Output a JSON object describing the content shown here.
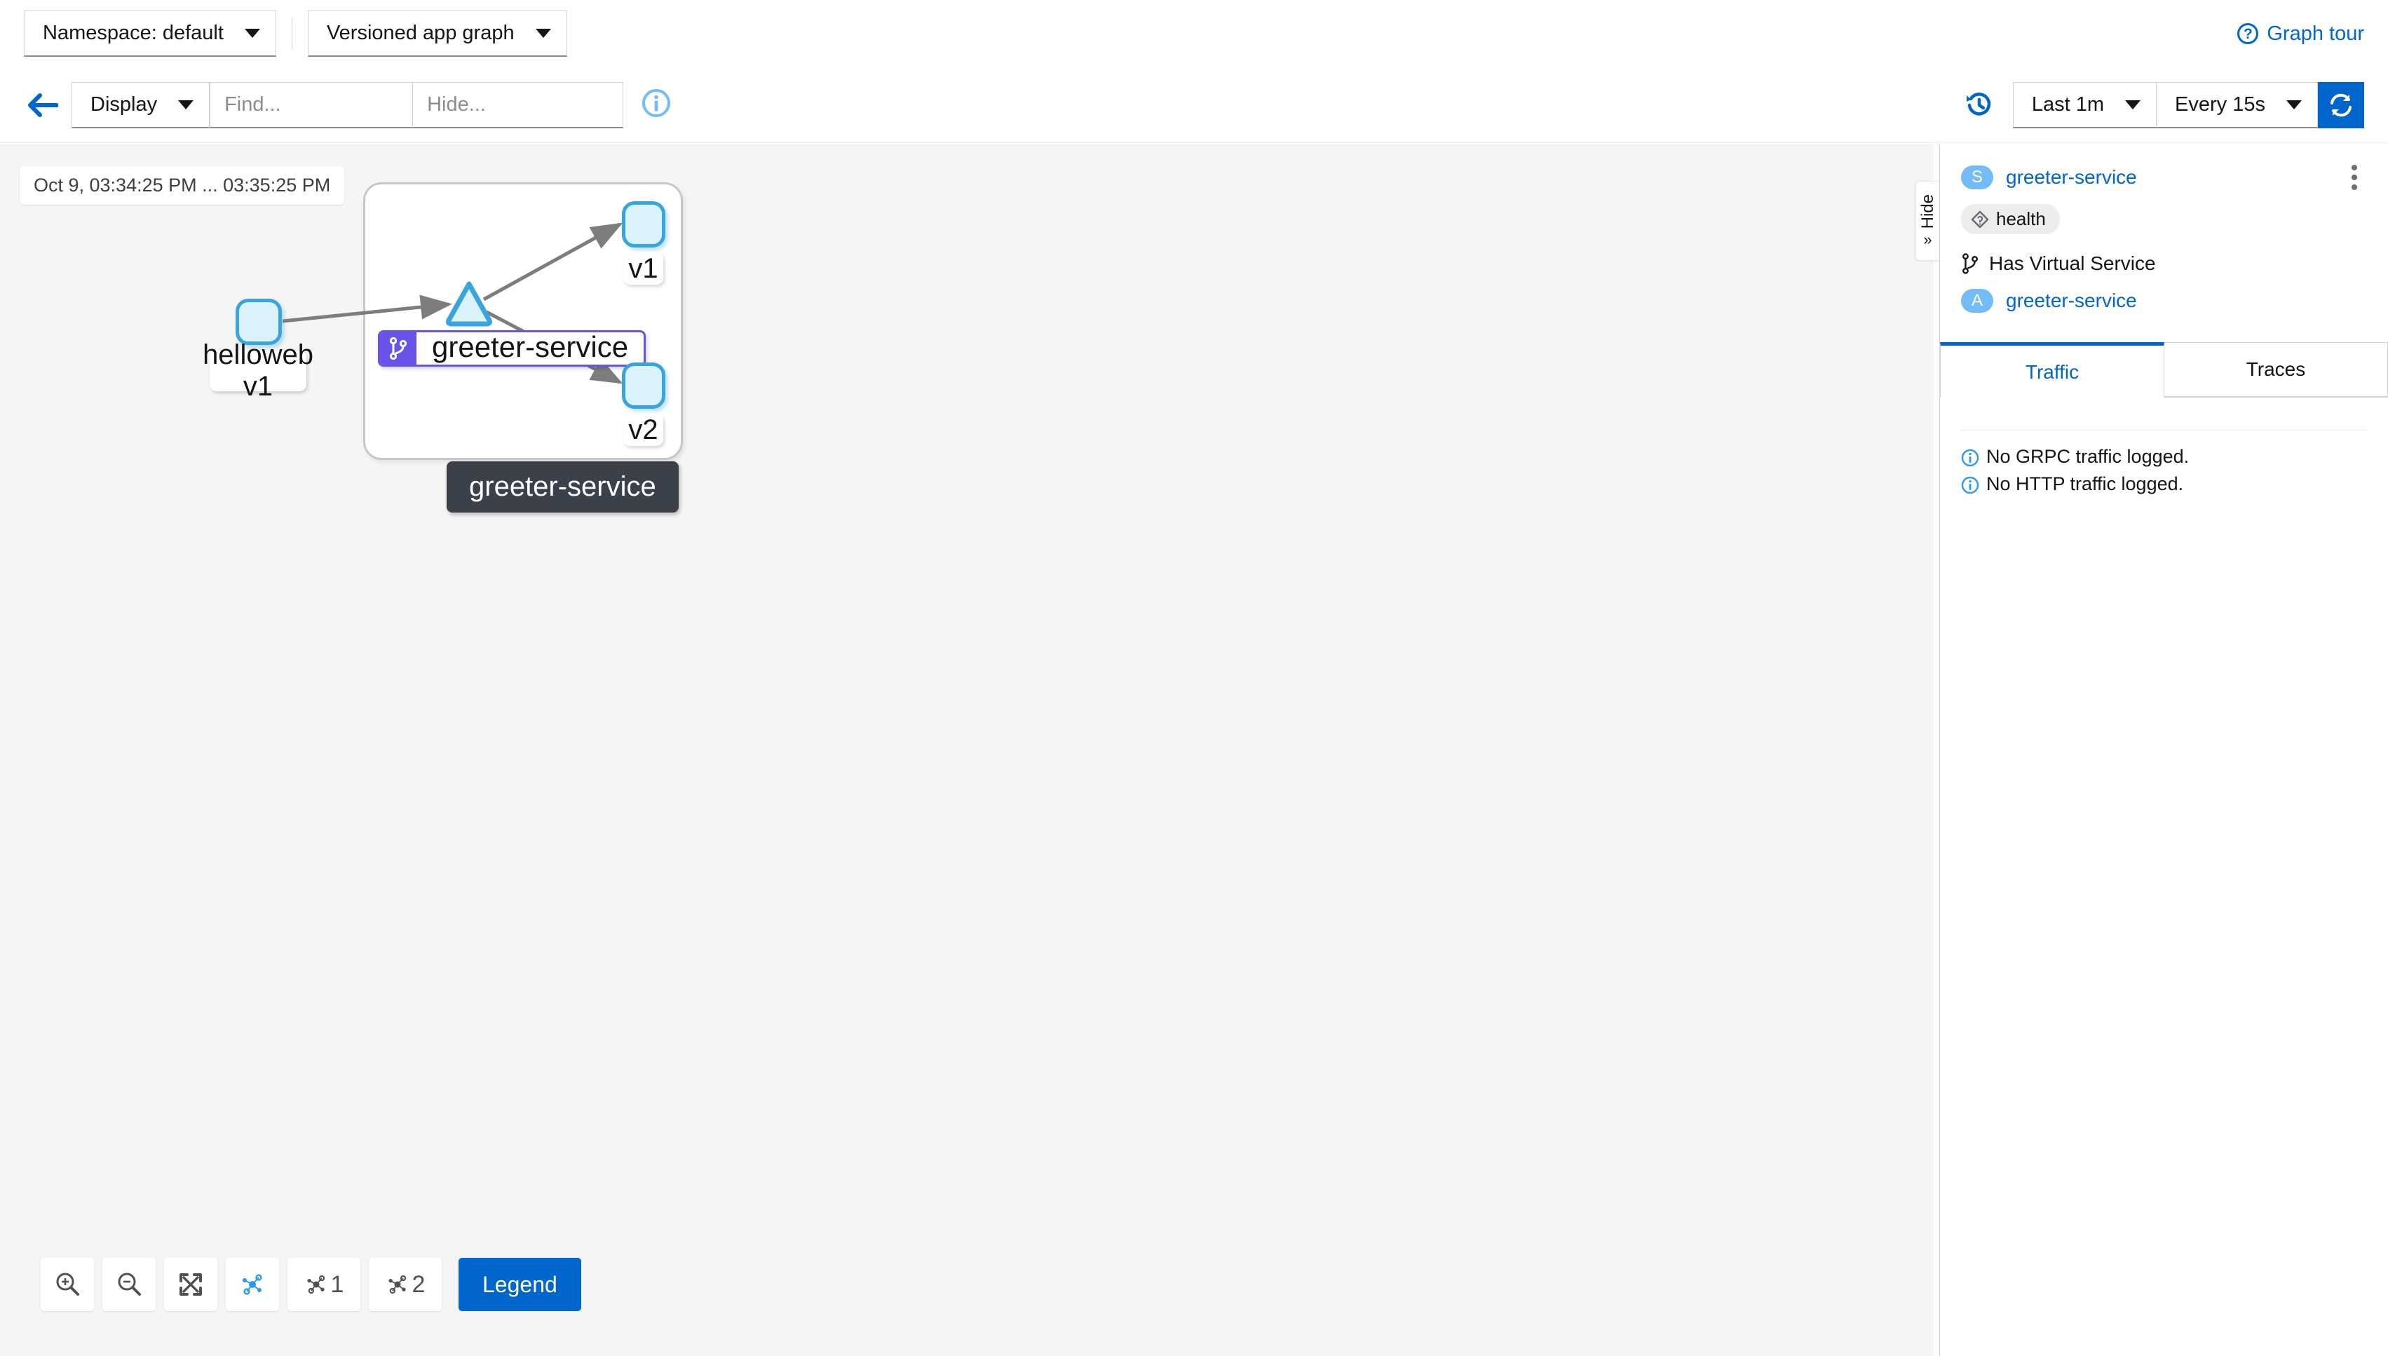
{
  "topbar": {
    "namespace_select": "Namespace: default",
    "graph_type_select": "Versioned app graph",
    "graph_tour_label": "Graph tour"
  },
  "toolbar": {
    "display_label": "Display",
    "find_placeholder": "Find...",
    "hide_placeholder": "Hide...",
    "find_value": "",
    "hide_value": "",
    "time_range": "Last 1m",
    "refresh_interval": "Every 15s"
  },
  "canvas": {
    "time_chip": "Oct 9, 03:34:25 PM ... 03:35:25 PM",
    "group_tooltip": "greeter-service",
    "nodes": [
      {
        "id": "helloweb",
        "label": "helloweb\nv1"
      },
      {
        "id": "greeter-service",
        "label": "greeter-service"
      },
      {
        "id": "v1",
        "label": "v1"
      },
      {
        "id": "v2",
        "label": "v2"
      }
    ]
  },
  "bottom_toolbar": {
    "zoom_in": "zoom-in",
    "zoom_out": "zoom-out",
    "fit": "fit-to-screen",
    "layout_default": "",
    "layout_1": "1",
    "layout_2": "2",
    "legend_label": "Legend"
  },
  "hide_tab": {
    "label": "Hide",
    "chevron": "»"
  },
  "sidepanel": {
    "service_badge": "S",
    "service_name": "greeter-service",
    "health_label": "health",
    "virtual_service_label": "Has Virtual Service",
    "app_badge": "A",
    "app_name": "greeter-service",
    "tabs": [
      {
        "label": "Traffic",
        "active": true
      },
      {
        "label": "Traces",
        "active": false
      }
    ],
    "messages": [
      "No GRPC traffic logged.",
      "No HTTP traffic logged."
    ]
  },
  "colors": {
    "accent_blue": "#0066cc",
    "node_border": "#39a5dc",
    "node_fill": "#daf2fc",
    "service_badge_purple": "#6753e8",
    "canvas_bg": "#f5f5f5",
    "edge_gray": "#7d7d7d",
    "tooltip_dark": "#3c4149"
  }
}
